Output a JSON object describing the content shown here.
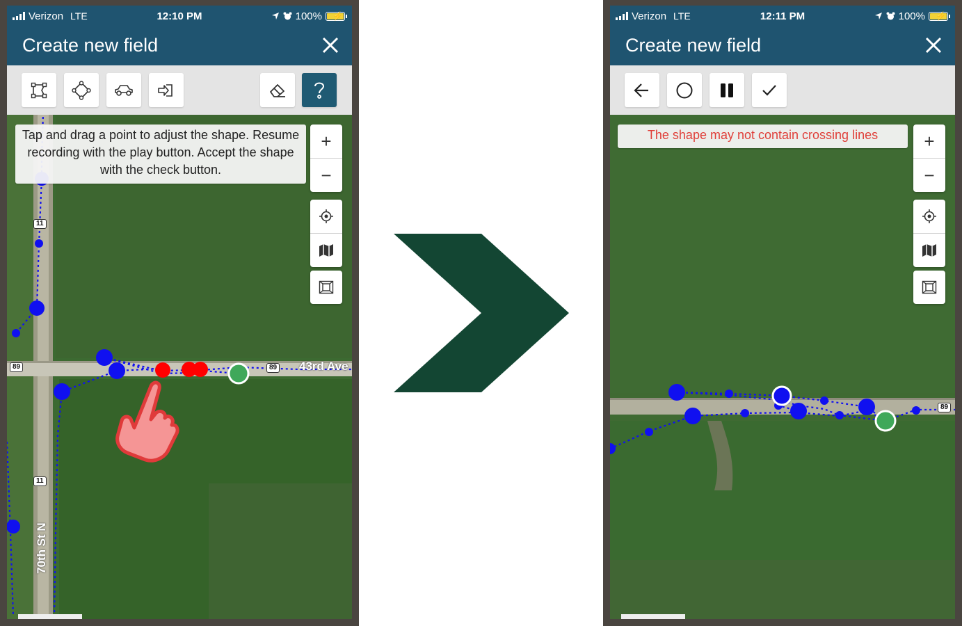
{
  "left_screen": {
    "status": {
      "carrier": "Verizon",
      "network": "LTE",
      "time": "12:10 PM",
      "battery": "100%"
    },
    "title": "Create new field",
    "toolbar": {
      "icons": [
        "draw-polygon-icon",
        "draw-shape-icon",
        "drive-boundary-icon",
        "import-icon",
        "eraser-icon",
        "help-icon"
      ],
      "active": "help-icon"
    },
    "notice": "Tap and drag a point to adjust the shape. Resume recording with the play button. Accept the shape with the check button.",
    "map": {
      "road_labels": [
        "43rd Ave",
        "70th St N"
      ],
      "shields": [
        "11",
        "89",
        "89",
        "11"
      ]
    },
    "map_controls": {
      "zoom_in": "+",
      "zoom_out": "−"
    }
  },
  "right_screen": {
    "status": {
      "carrier": "Verizon",
      "network": "LTE",
      "time": "12:11 PM",
      "battery": "100%"
    },
    "title": "Create new field",
    "toolbar": {
      "icons": [
        "back-arrow-icon",
        "record-circle-icon",
        "pause-icon",
        "check-icon"
      ]
    },
    "notice": "The shape may not contain crossing lines",
    "map": {
      "shields": [
        "89"
      ]
    },
    "map_controls": {
      "zoom_in": "+",
      "zoom_out": "−"
    }
  },
  "colors": {
    "header": "#1f5470",
    "toolbar": "#e4e4e4",
    "active_button": "#1f5a73",
    "error_text": "#e0403a",
    "arrow": "#134633",
    "point_blue": "#1010f0",
    "point_red": "#ff0000",
    "point_green": "#3fa85a"
  }
}
